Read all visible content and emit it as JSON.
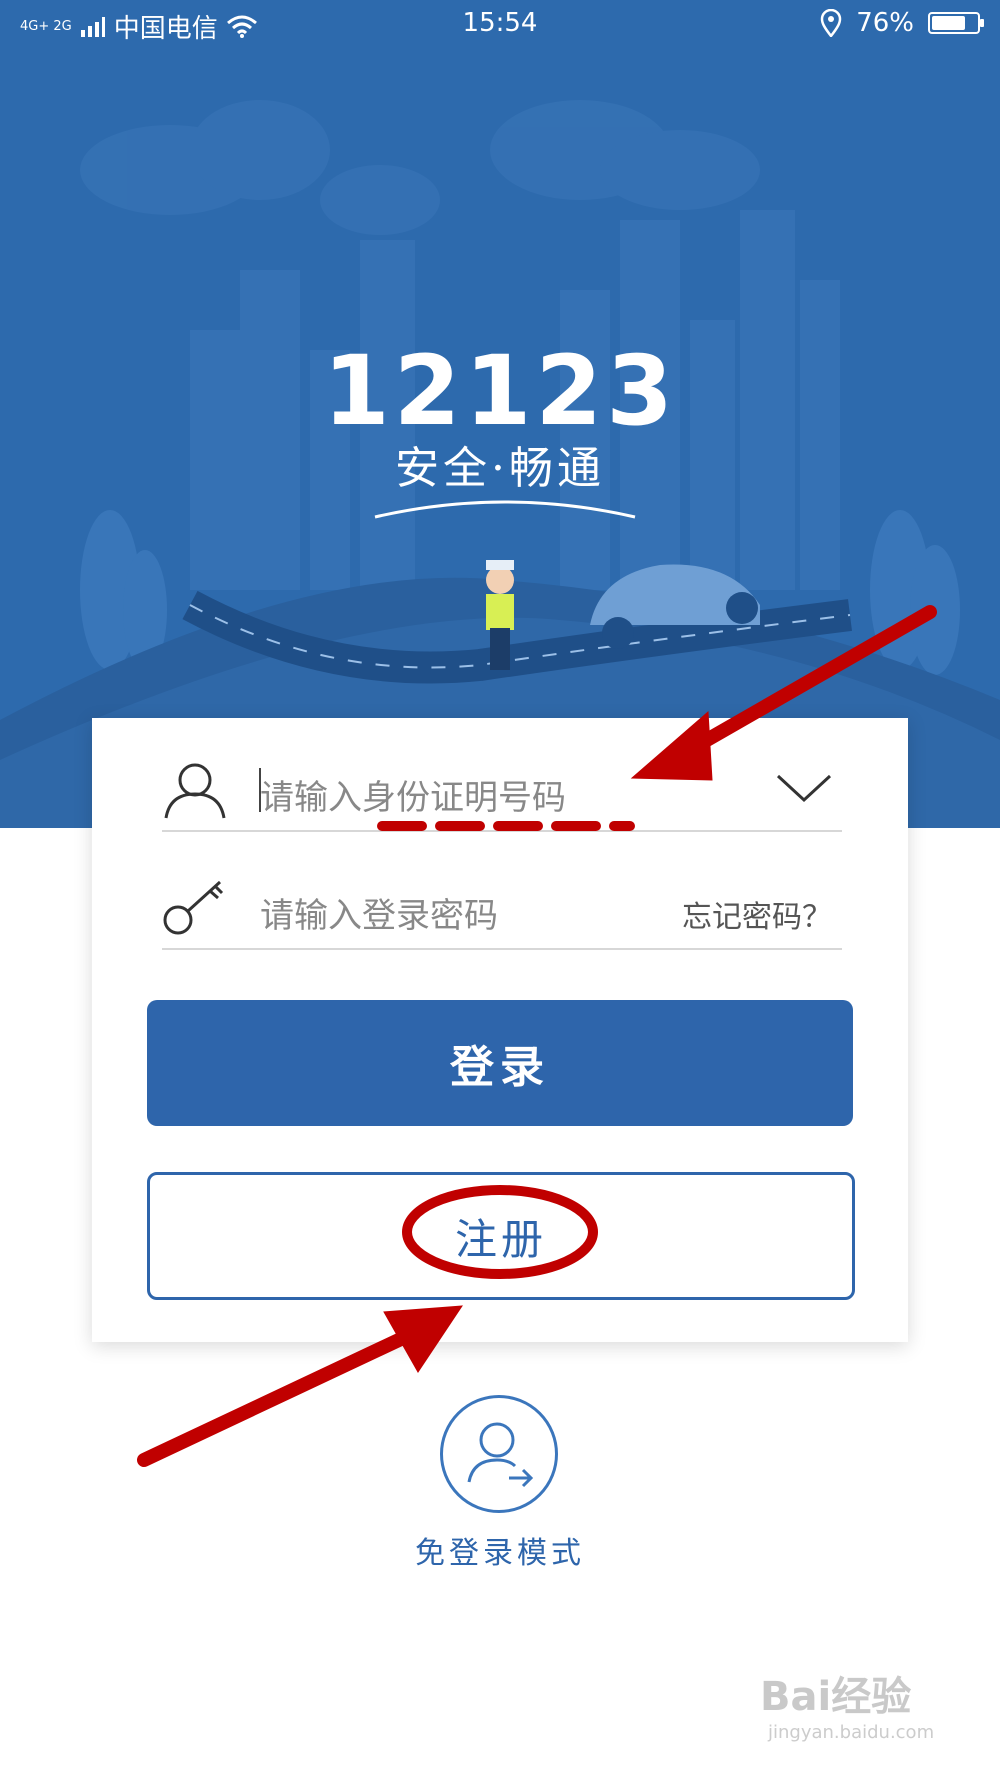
{
  "status_bar": {
    "network": "4G+ 2G",
    "carrier": "中国电信",
    "time": "15:54",
    "battery": "76%",
    "battery_level": 0.76,
    "icons": [
      "signal-icon",
      "wifi-icon",
      "location-icon",
      "battery-icon"
    ]
  },
  "hero": {
    "logo_text": "12123",
    "slogan": "安全·畅通",
    "background_color": "#2d6aad"
  },
  "login_form": {
    "id_field": {
      "placeholder": "请输入身份证明号码",
      "icon": "user-icon",
      "dropdown_icon": "chevron-down-icon"
    },
    "password_field": {
      "placeholder": "请输入登录密码",
      "icon": "key-icon",
      "forgot_link": "忘记密码？"
    },
    "login_button": "登录",
    "register_button": "注册",
    "accent_color": "#2e65ab"
  },
  "guest_mode": {
    "icon": "guest-user-icon",
    "label": "免登录模式"
  },
  "watermark": {
    "brand": "Bai经验",
    "domain": "jingyan.baidu.com"
  },
  "annotation_color": "#c00000"
}
